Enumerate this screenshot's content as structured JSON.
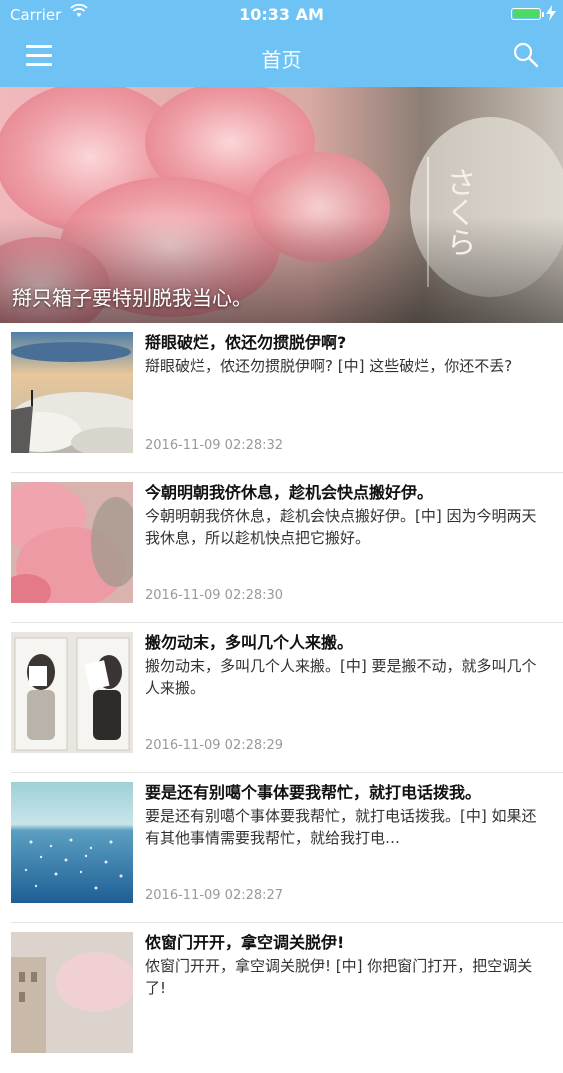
{
  "status_bar": {
    "carrier": "Carrier",
    "time": "10:33 AM",
    "battery_level": 1.0
  },
  "nav": {
    "title": "首页"
  },
  "banner": {
    "caption": "搿只箱子要特别脱我当心。",
    "watermark": "さくら"
  },
  "items": [
    {
      "title": "搿眼破烂，侬还勿掼脱伊啊?",
      "summary": "搿眼破烂，侬还勿掼脱伊啊? [中] 这些破烂，你还不丢?",
      "date": "2016-11-09 02:28:32"
    },
    {
      "title": "今朝明朝我侪休息，趁机会快点搬好伊。",
      "summary": "今朝明朝我侪休息，趁机会快点搬好伊。[中] 因为今明两天我休息，所以趁机快点把它搬好。",
      "date": "2016-11-09 02:28:30"
    },
    {
      "title": "搬勿动末，多叫几个人来搬。",
      "summary": "搬勿动末，多叫几个人来搬。[中] 要是搬不动，就多叫几个人来搬。",
      "date": "2016-11-09 02:28:29"
    },
    {
      "title": "要是还有别噶个事体要我帮忙，就打电话拨我。",
      "summary": "要是还有别噶个事体要我帮忙，就打电话拨我。[中] 如果还有其他事情需要我帮忙，就给我打电…",
      "date": "2016-11-09 02:28:27"
    },
    {
      "title": "侬窗门开开，拿空调关脱伊!",
      "summary": "侬窗门开开，拿空调关脱伊! [中] 你把窗门打开，把空调关了!",
      "date": ""
    }
  ]
}
